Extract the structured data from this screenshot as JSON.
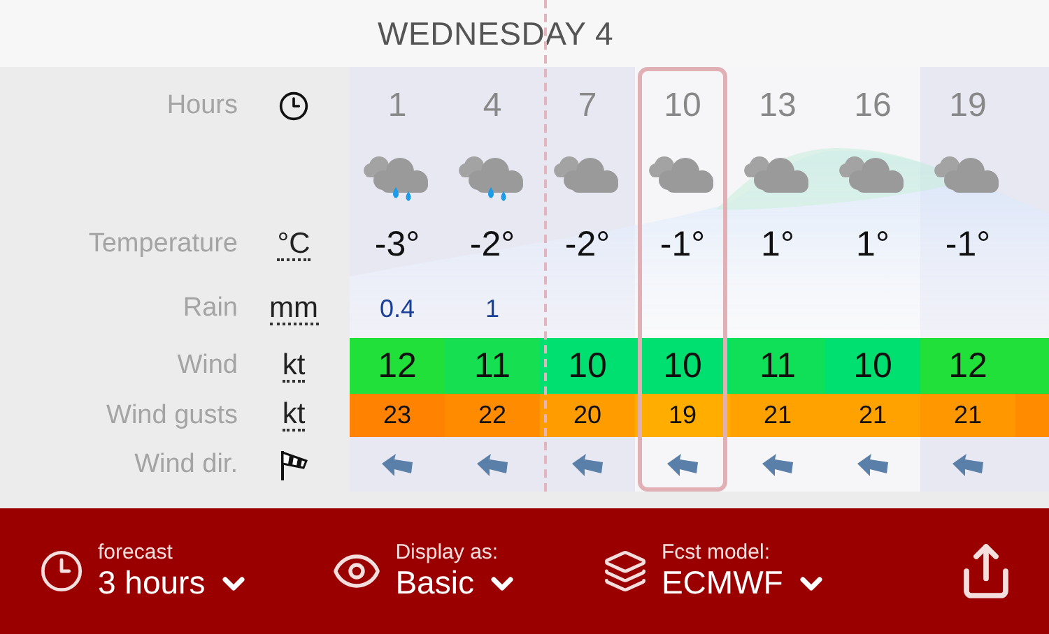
{
  "day_header": "WEDNESDAY 4",
  "rows": [
    {
      "kind": "hours",
      "label": "Hours"
    },
    {
      "kind": "weather"
    },
    {
      "kind": "temperature",
      "label": "Temperature",
      "unit": "°C"
    },
    {
      "kind": "rain",
      "label": "Rain",
      "unit": "mm"
    },
    {
      "kind": "wind",
      "label": "Wind",
      "unit": "kt"
    },
    {
      "kind": "gusts",
      "label": "Wind gusts",
      "unit": "kt"
    },
    {
      "kind": "direction",
      "label": "Wind dir."
    }
  ],
  "columns": [
    {
      "hour": "1",
      "kind": "rain",
      "temperature": "-3°",
      "rain": "0.4",
      "wind": {
        "value": "12",
        "color": "#22e03a"
      },
      "gusts": {
        "value": "23",
        "color": "#ff8200"
      },
      "night": true,
      "selected": false
    },
    {
      "hour": "4",
      "kind": "rain",
      "temperature": "-2°",
      "rain": "1",
      "wind": {
        "value": "11",
        "color": "#16e052"
      },
      "gusts": {
        "value": "22",
        "color": "#ff8c00"
      },
      "night": true,
      "selected": false
    },
    {
      "hour": "7",
      "kind": "cloud",
      "temperature": "-2°",
      "wind": {
        "value": "10",
        "color": "#00e070"
      },
      "gusts": {
        "value": "20",
        "color": "#ff9c00"
      },
      "night": true,
      "selected": false
    },
    {
      "hour": "10",
      "kind": "cloud",
      "temperature": "-1°",
      "wind": {
        "value": "10",
        "color": "#00e070"
      },
      "gusts": {
        "value": "19",
        "color": "#ffae00"
      },
      "night": false,
      "selected": true
    },
    {
      "hour": "13",
      "kind": "cloud",
      "temperature": "1°",
      "wind": {
        "value": "11",
        "color": "#10e058"
      },
      "gusts": {
        "value": "21",
        "color": "#ffa200"
      },
      "night": false,
      "selected": false
    },
    {
      "hour": "16",
      "kind": "cloud",
      "temperature": "1°",
      "wind": {
        "value": "10",
        "color": "#00e070"
      },
      "gusts": {
        "value": "21",
        "color": "#ffa200"
      },
      "night": false,
      "selected": false
    },
    {
      "hour": "19",
      "kind": "cloud",
      "temperature": "-1°",
      "wind": {
        "value": "12",
        "color": "#22e03a"
      },
      "gusts": {
        "value": "21",
        "color": "#ff9800"
      },
      "night": true,
      "selected": false
    },
    {
      "wind": {
        "color": "#22e03a"
      },
      "gusts": {
        "color": "#ff8c00"
      },
      "night": true,
      "selected": false
    }
  ],
  "bottom_bar": [
    {
      "kind": "clock",
      "caption": "forecast",
      "value": "3 hours"
    },
    {
      "kind": "eye",
      "caption": "Display as:",
      "value": "Basic"
    },
    {
      "kind": "layers",
      "caption": "Fcst model:",
      "value": "ECMWF"
    }
  ]
}
